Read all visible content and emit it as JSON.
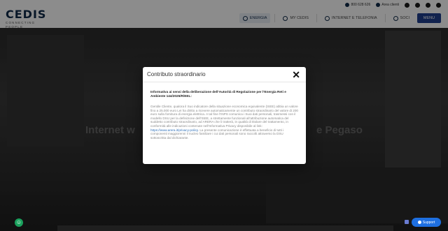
{
  "header": {
    "logo_main": "CEDIS",
    "logo_sub": "CONNECTING PEOPLE",
    "topbar": [
      {
        "label": "800 628 626",
        "icon": "phone-icon"
      },
      {
        "label": "Area clienti",
        "icon": "user-icon"
      }
    ],
    "social_icons": [
      "facebook-icon",
      "linkedin-icon",
      "instagram-icon",
      "youtube-icon"
    ],
    "nav": [
      {
        "label": "ENERGIA",
        "icon": "bolt-icon",
        "active": true
      },
      {
        "label": "MY CEDIS",
        "icon": "user-icon",
        "active": false
      },
      {
        "label": "INTERNET E TELEFONIA",
        "icon": "wifi-icon",
        "active": false
      },
      {
        "label": "SOCI",
        "icon": "people-icon",
        "active": false
      }
    ],
    "nav_button": "MENU"
  },
  "hero": {
    "title_left": "Internet w",
    "title_right": "e Pegaso"
  },
  "modal": {
    "title": "Contributo straordinario",
    "close_label": "✕",
    "intro": "Informativa ai sensi della deliberazione dell’Autorità di Regolazione per l’Energia Reti e Ambiente 144/2025/R/EEL:",
    "paragraph_before_link": "Gentile Cliente, qualora il Suo indicatore della situazione economica equivalente (ISEE) abbia un valore fino a 25.000 euro Lei ha diritto a ricevere automaticamente un contributo straordinario del valore di 200 euro sulla fornitura di energia elettrica. A tal fine l’INPS comunica i Suoi dati personali, trasmessi con il modello DSU per la definizione dell’ISEE, a strettamente funzionali all’attribuzione automatica del suddetto contributo straordinario, ad ARERA che li tratterà, in qualità di titolare del trattamento, in conformità alle indicazioni contenute nell’Informativa Privacy disponibile al link: ",
    "link": "https://www.arera.it/privacy-policy",
    "paragraph_after_link": ". La presente comunicazione è effettuata a beneficio di tutti i componenti maggiorenni il nucleo familiare i cui dati personali sono raccolti attraverso la DSU sottoscritta dal dichiarante."
  },
  "floating": {
    "accessibility_icon": "accessibility-icon",
    "support_label": "Support"
  },
  "colors": {
    "brand_dark": "#0f2a4a",
    "brand_accent": "#17a3d6",
    "nav_button": "#1f3f8f",
    "support_button": "#1e6fe0",
    "accessibility_button": "#1aa15d",
    "link": "#2d6fb8"
  }
}
